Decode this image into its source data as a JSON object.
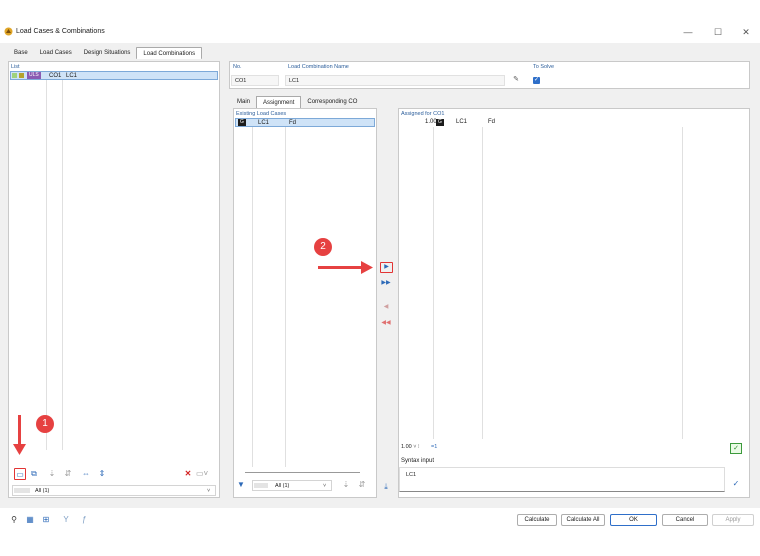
{
  "window": {
    "title": "Load Cases & Combinations",
    "minimize": "—",
    "maximize": "☐",
    "close": "✕"
  },
  "tabs": [
    "Base",
    "Load Cases",
    "Design Situations",
    "Load Combinations"
  ],
  "list": {
    "label": "List",
    "row": {
      "badge": "ULS",
      "no": "CO1",
      "name": "LC1"
    },
    "filter": "All (1)"
  },
  "header": {
    "no_label": "No.",
    "no_value": "CO1",
    "name_label": "Load Combination Name",
    "name_value": "LC1",
    "solve_label": "To Solve"
  },
  "subtabs": [
    "Main",
    "Assignment",
    "Corresponding CO"
  ],
  "existing": {
    "label": "Existing Load Cases",
    "row": {
      "badge": "G",
      "name": "LC1",
      "type": "Fd"
    },
    "filter": "All (1)"
  },
  "assigned": {
    "label": "Assigned for CO1",
    "row": {
      "factor": "1.00",
      "badge": "G",
      "name": "LC1",
      "type": "Fd"
    },
    "factor_value": "1.00",
    "factor_set": "=1",
    "syntax_label": "Syntax input",
    "syntax_value": "LC1"
  },
  "markers": [
    "1",
    "2"
  ],
  "footer": {
    "calculate": "Calculate",
    "calculate_all": "Calculate All",
    "ok": "OK",
    "cancel": "Cancel",
    "apply": "Apply"
  },
  "colors": {
    "uls": "#8a5bb3",
    "g_badge": "#1c1c1c",
    "accent": "#2f6fc9",
    "marker": "#e64141"
  }
}
